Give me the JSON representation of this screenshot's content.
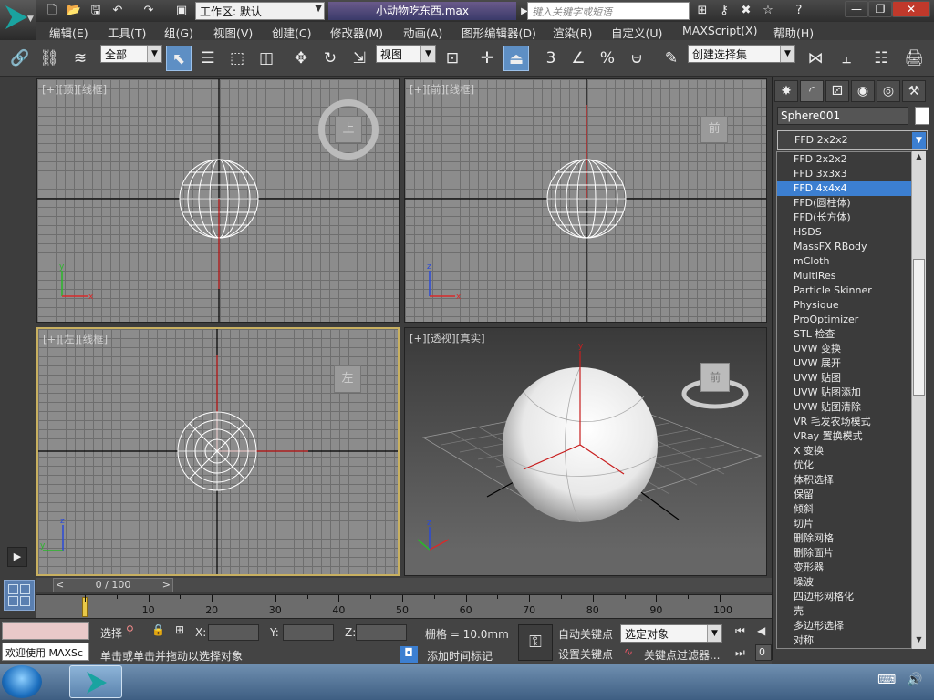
{
  "window": {
    "workspace_label": "工作区: 默认",
    "doc_title": "小动物吃东西.max",
    "search_placeholder": "键入关键字或短语"
  },
  "menus": [
    "编辑(E)",
    "工具(T)",
    "组(G)",
    "视图(V)",
    "创建(C)",
    "修改器(M)",
    "动画(A)",
    "图形编辑器(D)",
    "渲染(R)",
    "自定义(U)",
    "MAXScript(X)",
    "帮助(H)"
  ],
  "toolbar": {
    "filter": "全部",
    "ref_coord": "视图",
    "named_sel": "创建选择集",
    "snap_num": "3",
    "percent": "%"
  },
  "viewports": {
    "top": {
      "label": "[+][顶][线框]",
      "cube": "上"
    },
    "front": {
      "label": "[+][前][线框]",
      "cube": "前"
    },
    "left": {
      "label": "[+][左][线框]",
      "cube": "左"
    },
    "persp": {
      "label": "[+][透视][真实]",
      "cube": "前"
    }
  },
  "axes": {
    "x": "x",
    "y": "y",
    "z": "z"
  },
  "command_panel": {
    "object_name": "Sphere001",
    "modifier_selected": "FFD 2x2x2",
    "modifier_list": [
      "FFD 2x2x2",
      "FFD 3x3x3",
      "FFD 4x4x4",
      "FFD(圆柱体)",
      "FFD(长方体)",
      "HSDS",
      "MassFX RBody",
      "mCloth",
      "MultiRes",
      "Particle Skinner",
      "Physique",
      "ProOptimizer",
      "STL 检查",
      "UVW 变换",
      "UVW 展开",
      "UVW 贴图",
      "UVW 贴图添加",
      "UVW 贴图清除",
      "VR 毛发农场模式",
      "VRay 置换模式",
      "X 变换",
      "优化",
      "体积选择",
      "保留",
      "倾斜",
      "切片",
      "删除网格",
      "删除面片",
      "变形器",
      "噪波",
      "四边形网格化",
      "壳",
      "多边形选择",
      "对称"
    ],
    "highlighted_index": 2
  },
  "timeline": {
    "frame_display": "0 / 100",
    "prev": "<",
    "next": ">",
    "ticks": [
      "10",
      "20",
      "30",
      "40",
      "50",
      "60",
      "70",
      "80",
      "90",
      "100"
    ]
  },
  "status": {
    "maxscript": "欢迎使用 MAXSc",
    "select_label": "选择",
    "x_label": "X:",
    "y_label": "Y:",
    "z_label": "Z:",
    "grid": "栅格 = 10.0mm",
    "prompt": "单击或单击并拖动以选择对象",
    "add_time_tag": "添加时间标记",
    "auto_key": "自动关键点",
    "set_key": "设置关键点",
    "key_mode": "选定对象",
    "key_filters": "关键点过滤器...",
    "frame_value": "0"
  }
}
